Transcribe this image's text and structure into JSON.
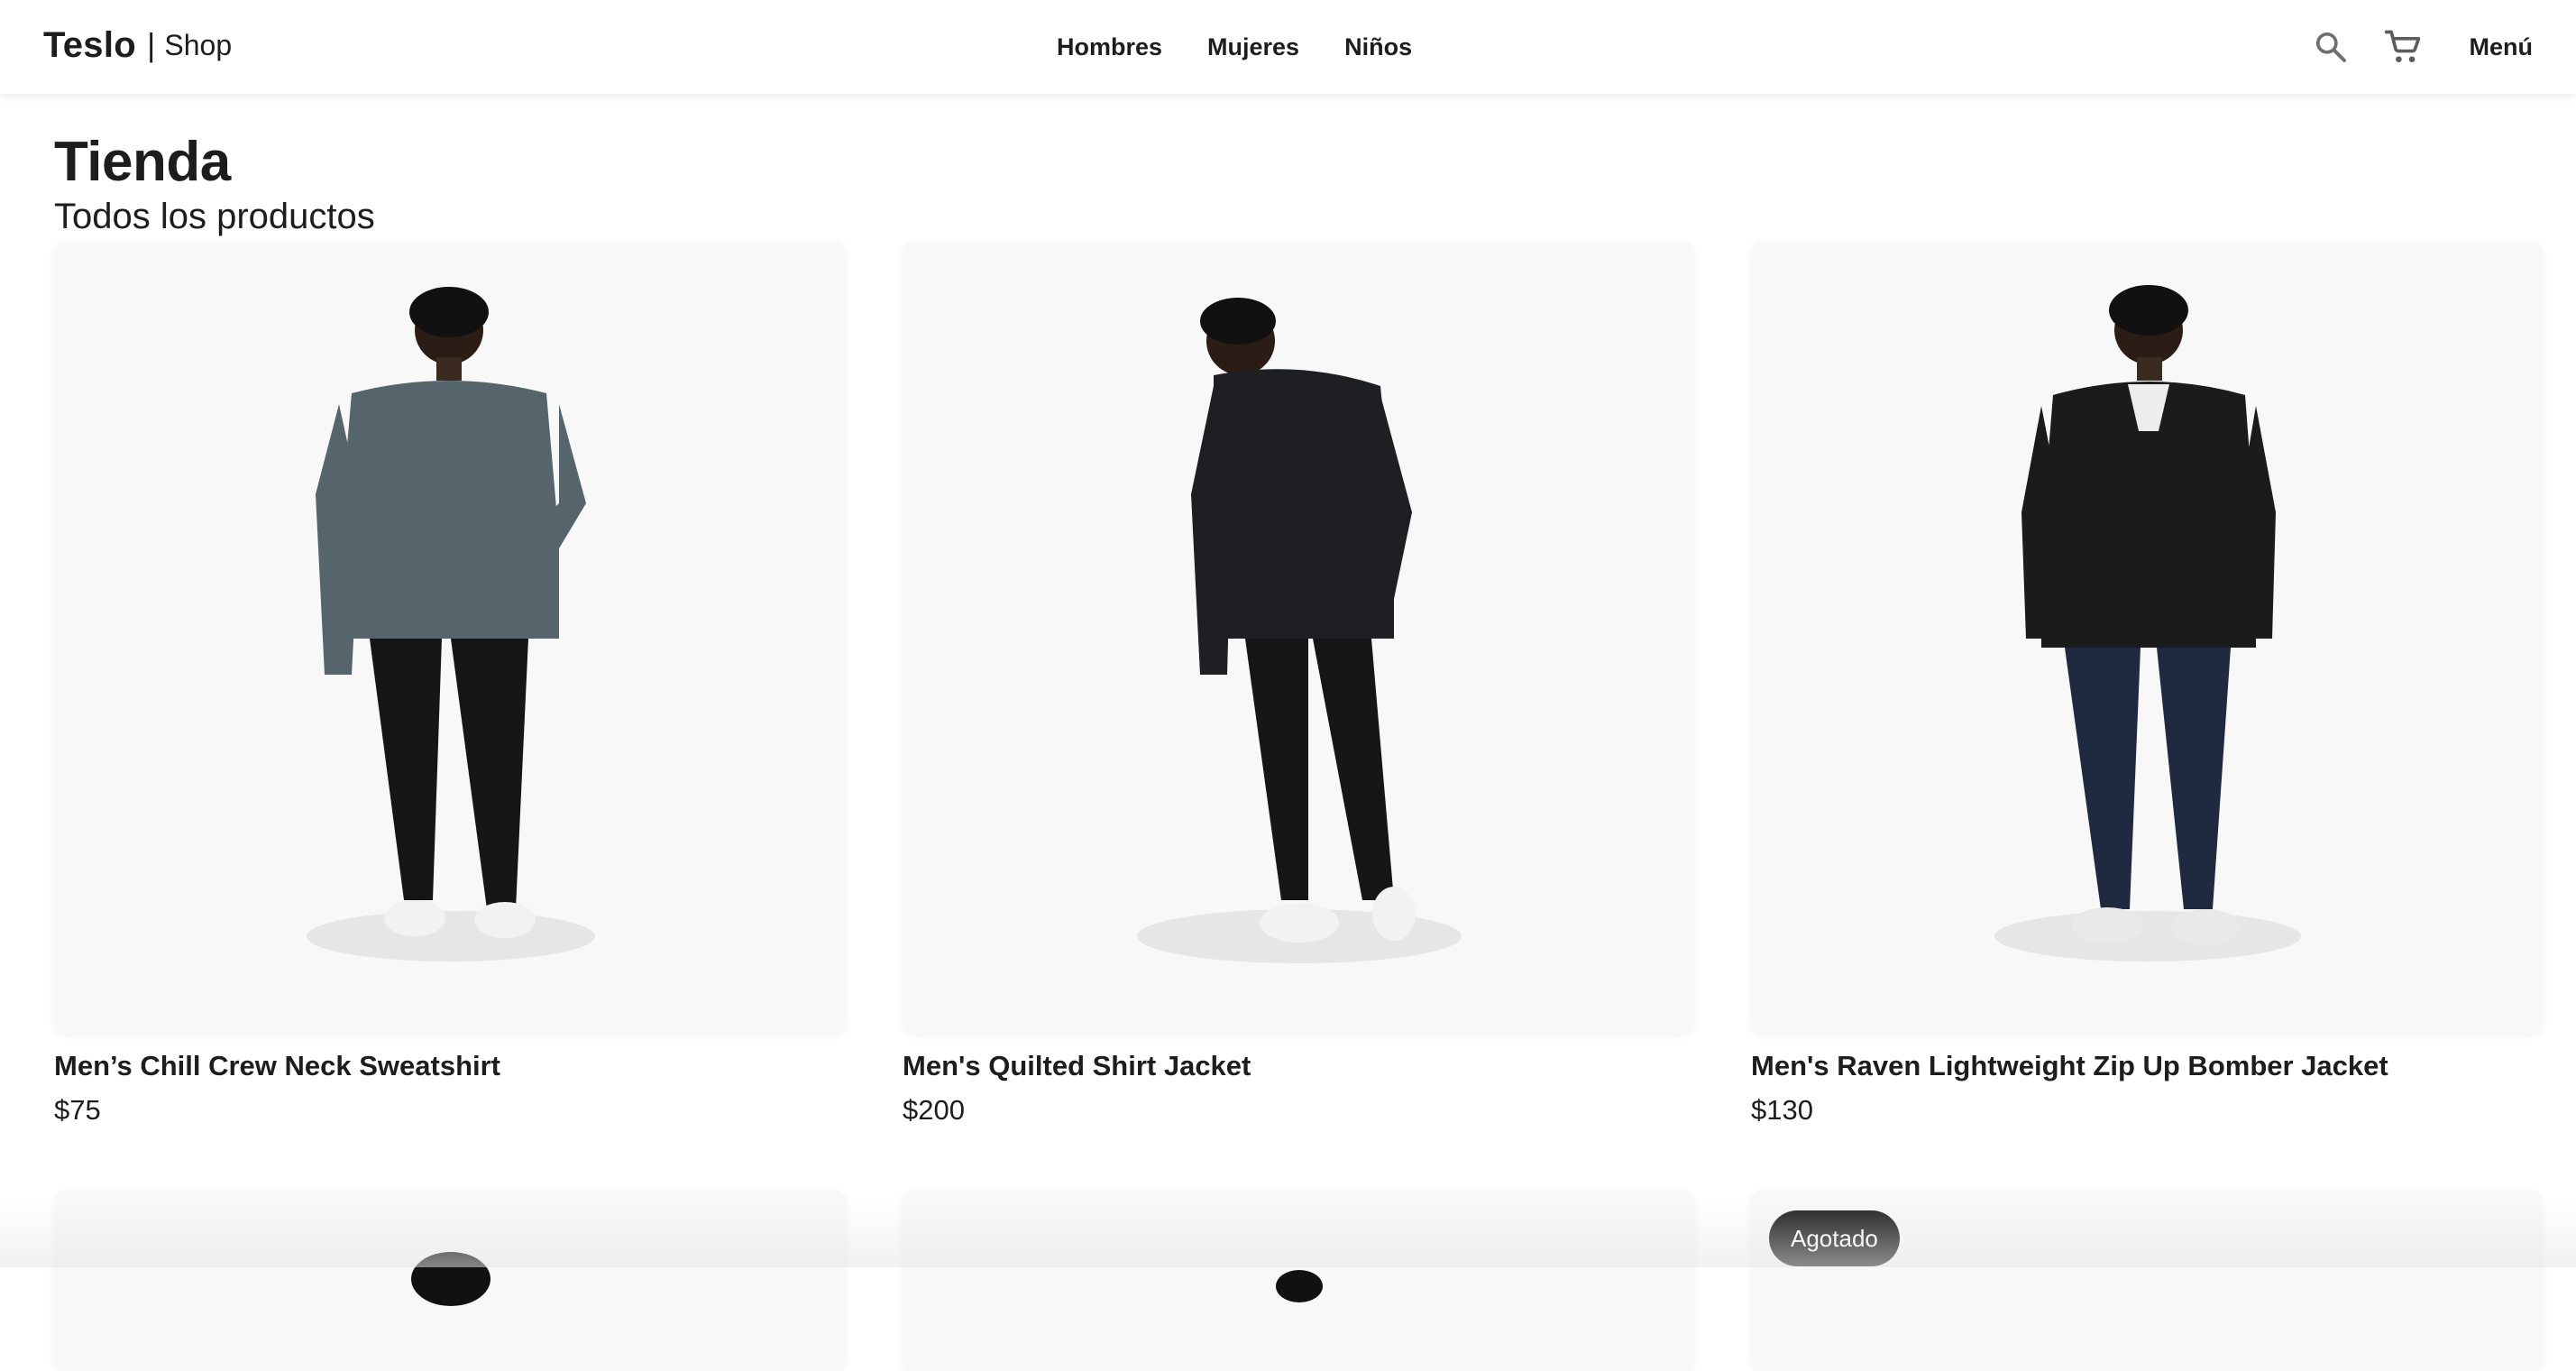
{
  "navbar": {
    "brand_name": "Teslo",
    "brand_separator": "|",
    "brand_shop": "Shop",
    "links": [
      {
        "label": "Hombres"
      },
      {
        "label": "Mujeres"
      },
      {
        "label": "Niños"
      }
    ],
    "icons": {
      "search": "search-icon",
      "cart": "cart-icon"
    },
    "menu_label": "Menú"
  },
  "page": {
    "title": "Tienda",
    "subtitle": "Todos los productos"
  },
  "products": [
    {
      "title": "Men’s Chill Crew Neck Sweatshirt",
      "price": "$75",
      "top_color": "#56646c",
      "bottom_color": "#161616"
    },
    {
      "title": "Men's Quilted Shirt Jacket",
      "price": "$200",
      "top_color": "#1e1f22",
      "bottom_color": "#161616"
    },
    {
      "title": "Men's Raven Lightweight Zip Up Bomber Jacket",
      "price": "$130",
      "top_color": "#1b1b1b",
      "bottom_color": "#1f2a40"
    }
  ],
  "next_row": {
    "badge": "Agotado"
  },
  "colors": {
    "text": "#1d1d1d",
    "card_bg": "#f8f8f8",
    "badge_bg": "#1f1f1f"
  }
}
